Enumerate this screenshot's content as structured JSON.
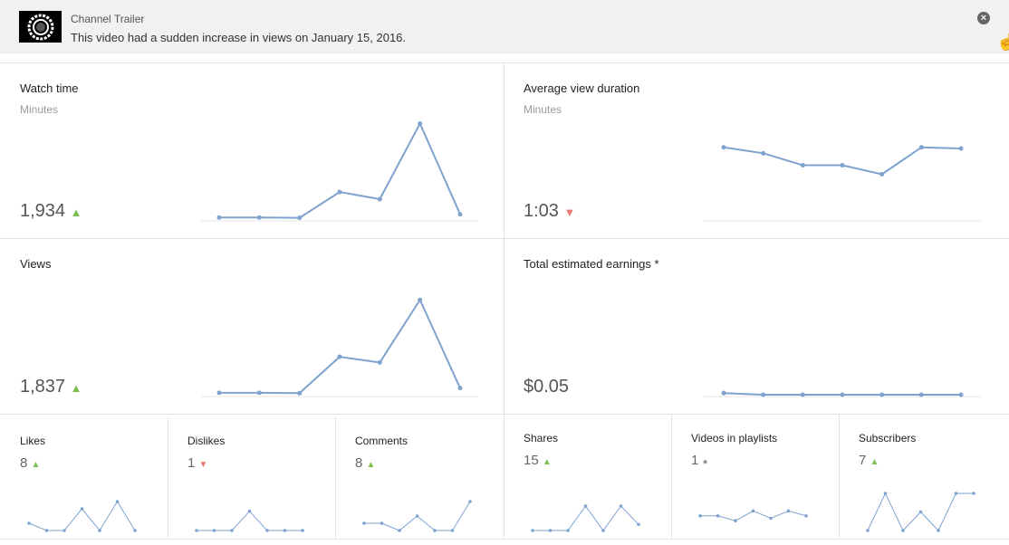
{
  "banner": {
    "thumbnail_label": "channel-trailer-thumbnail",
    "title": "Channel Trailer",
    "message": "This video had a sudden increase in views on January 15, 2016.",
    "close_icon": "×"
  },
  "colors": {
    "line": "#7fa3cf",
    "up": "#7cc04f",
    "down": "#e87c74",
    "neutral": "#999999"
  },
  "cards": {
    "watch_time": {
      "title": "Watch time",
      "unit": "Minutes",
      "value": "1,934",
      "trend": "up",
      "trend_glyph": "▲"
    },
    "avg_view_duration": {
      "title": "Average view duration",
      "unit": "Minutes",
      "value": "1:03",
      "trend": "down",
      "trend_glyph": "▼"
    },
    "views": {
      "title": "Views",
      "value": "1,837",
      "trend": "up",
      "trend_glyph": "▲"
    },
    "earnings": {
      "title": "Total estimated earnings *",
      "value": "$0.05"
    },
    "likes": {
      "title": "Likes",
      "value": "8",
      "trend": "up",
      "trend_glyph": "▲"
    },
    "dislikes": {
      "title": "Dislikes",
      "value": "1",
      "trend": "down",
      "trend_glyph": "▼"
    },
    "comments": {
      "title": "Comments",
      "value": "8",
      "trend": "up",
      "trend_glyph": "▲"
    },
    "shares": {
      "title": "Shares",
      "value": "15",
      "trend": "up",
      "trend_glyph": "▲"
    },
    "playlists": {
      "title": "Videos in playlists",
      "value": "1",
      "trend": "neutral",
      "trend_glyph": "●"
    },
    "subscribers": {
      "title": "Subscribers",
      "value": "7",
      "trend": "up",
      "trend_glyph": "▲"
    }
  },
  "chart_data": [
    {
      "type": "line",
      "title": "Watch time",
      "values": [
        10,
        10,
        8,
        170,
        125,
        600,
        30
      ],
      "ylim": [
        0,
        620
      ]
    },
    {
      "type": "line",
      "title": "Average view duration",
      "values": [
        1.2,
        1.1,
        0.9,
        0.9,
        0.75,
        1.2,
        1.18
      ],
      "ylim": [
        0,
        1.65
      ]
    },
    {
      "type": "line",
      "title": "Views",
      "values": [
        10,
        10,
        8,
        200,
        170,
        500,
        35
      ],
      "ylim": [
        0,
        520
      ]
    },
    {
      "type": "line",
      "title": "Total estimated earnings",
      "values": [
        0.01,
        0,
        0,
        0,
        0,
        0,
        0
      ],
      "ylim": [
        0,
        0.6
      ]
    },
    {
      "type": "line",
      "title": "Likes",
      "values": [
        1,
        0,
        0,
        3,
        0,
        4,
        0
      ],
      "ylim": [
        0,
        4
      ]
    },
    {
      "type": "line",
      "title": "Dislikes",
      "values": [
        0,
        0,
        0,
        1,
        0,
        0,
        0
      ],
      "ylim": [
        0,
        1.5
      ]
    },
    {
      "type": "line",
      "title": "Comments",
      "values": [
        1,
        1,
        0,
        2,
        0,
        0,
        4
      ],
      "ylim": [
        0,
        4
      ]
    },
    {
      "type": "line",
      "title": "Shares",
      "values": [
        0,
        0,
        0,
        4,
        0,
        4,
        1
      ],
      "ylim": [
        0,
        4
      ]
    },
    {
      "type": "line",
      "title": "Videos in playlists",
      "values": [
        1,
        1,
        0,
        2,
        0.5,
        2,
        1
      ],
      "ylim": [
        -2,
        3
      ]
    },
    {
      "type": "line",
      "title": "Subscribers",
      "values": [
        0,
        2,
        0,
        1,
        0,
        2,
        2
      ],
      "ylim": [
        0,
        2
      ]
    }
  ]
}
